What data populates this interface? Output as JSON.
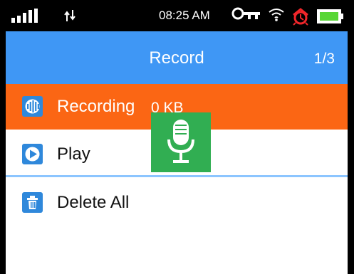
{
  "status_bar": {
    "time": "08:25 AM",
    "signal_icon": "signal-strength-icon",
    "data_icon": "data-transfer-icon",
    "key_icon": "key-icon",
    "wifi_icon": "wifi-icon",
    "alarm_icon": "alarm-clock-icon",
    "battery_icon": "battery-icon",
    "battery_color": "#58d636"
  },
  "header": {
    "title": "Record",
    "page_indicator": "1/3",
    "background_color": "#3f97f5"
  },
  "menu": {
    "items": [
      {
        "label": "Recording",
        "size": "0 KB",
        "icon": "audio-wave-icon",
        "active": true
      },
      {
        "label": "Play",
        "icon": "play-icon",
        "active": false
      },
      {
        "label": "Delete All",
        "icon": "trash-icon",
        "active": false
      }
    ],
    "active_color": "#fb6614",
    "divider_color": "#8cc5ff",
    "icon_color": "#2f88db"
  },
  "recording_indicator": {
    "icon": "microphone-icon",
    "background_color": "#31ae52"
  }
}
